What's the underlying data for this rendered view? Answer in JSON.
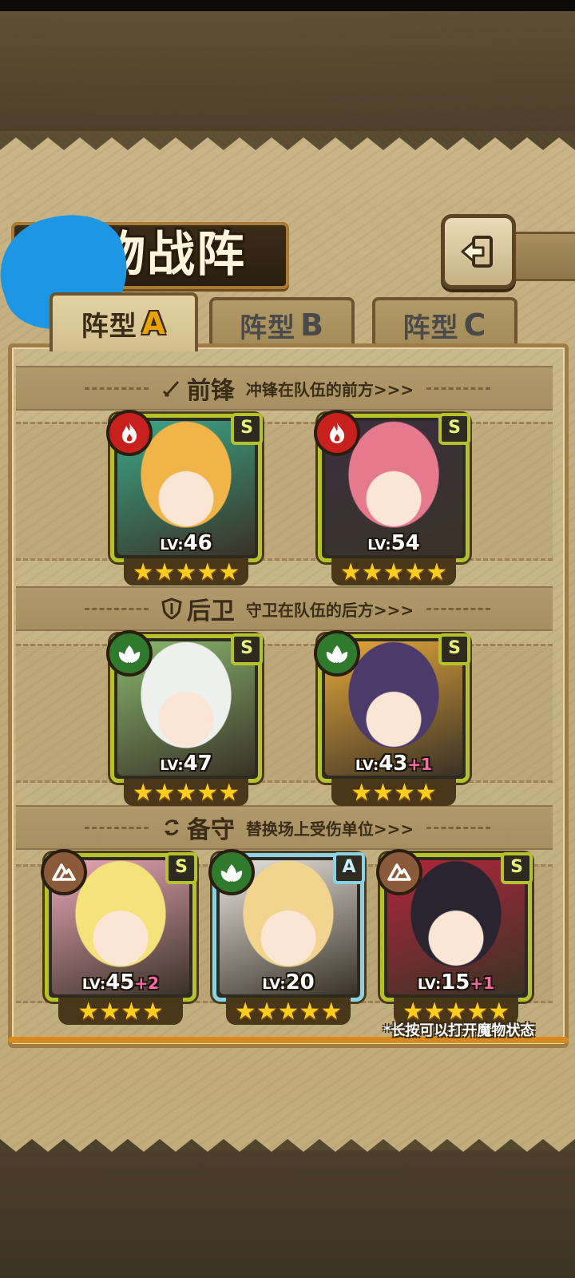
{
  "header": {
    "title": "魔物战阵",
    "back_icon": "back-arrow-icon"
  },
  "tabs": [
    {
      "label": "阵型",
      "letter": "A",
      "active": true
    },
    {
      "label": "阵型",
      "letter": "B",
      "active": false
    },
    {
      "label": "阵型",
      "letter": "C",
      "active": false
    }
  ],
  "sections": {
    "front": {
      "icon": "sword-icon",
      "name": "前锋",
      "desc": "冲锋在队伍的前方>>>"
    },
    "back": {
      "icon": "shield-icon",
      "name": "后卫",
      "desc": "守卫在队伍的后方>>>"
    },
    "reserve": {
      "icon": "swap-icon",
      "name": "备守",
      "desc": "替换场上受伤单位>>>"
    }
  },
  "cards": {
    "front": [
      {
        "element": "fire",
        "rank": "S",
        "lv_prefix": "LV:",
        "lv": "46",
        "bonus": "",
        "stars": "★★★★★",
        "hair": "#f1b448",
        "accent": "#3aa889"
      },
      {
        "element": "fire",
        "rank": "S",
        "lv_prefix": "LV:",
        "lv": "54",
        "bonus": "",
        "stars": "★★★★★",
        "hair": "#e57a8e",
        "accent": "#3b3040"
      }
    ],
    "back": [
      {
        "element": "wood",
        "rank": "S",
        "lv_prefix": "LV:",
        "lv": "47",
        "bonus": "",
        "stars": "★★★★★",
        "hair": "#eef0ee",
        "accent": "#89b870"
      },
      {
        "element": "wood",
        "rank": "S",
        "lv_prefix": "LV:",
        "lv": "43",
        "bonus": "+1",
        "stars": "★★★★",
        "hair": "#4c3a6a",
        "accent": "#e6a83a"
      }
    ],
    "reserve": [
      {
        "element": "earth",
        "rank": "S",
        "lv_prefix": "LV:",
        "lv": "45",
        "bonus": "+2",
        "stars": "★★★★",
        "hair": "#f4e27a",
        "accent": "#e9a7b8"
      },
      {
        "element": "wood",
        "rank": "A",
        "lv_prefix": "LV:",
        "lv": "20",
        "bonus": "",
        "stars": "★★★★★",
        "hair": "#f1d58e",
        "accent": "#e9e6e0"
      },
      {
        "element": "earth",
        "rank": "S",
        "lv_prefix": "LV:",
        "lv": "15",
        "bonus": "+1",
        "stars": "★★★★★",
        "hair": "#2a2430",
        "accent": "#b1273a"
      }
    ]
  },
  "footnote": "*长按可以打开魔物状态",
  "colors": {
    "card_border": "#b6c22b",
    "card_border_a": "#8ad2e6",
    "star": "#ffcd1e",
    "bonus": "#ff68a8"
  }
}
